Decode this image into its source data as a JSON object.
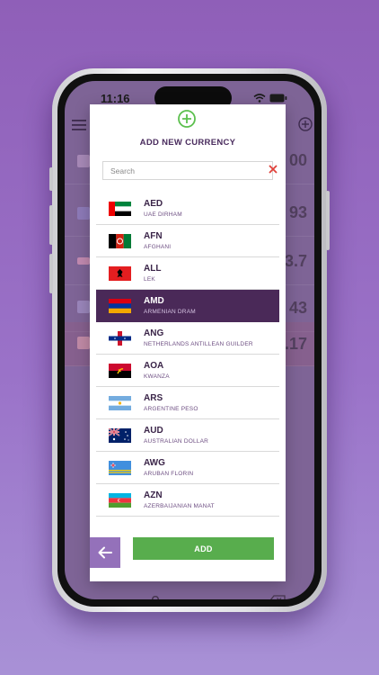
{
  "status": {
    "time": "11:16"
  },
  "background": {
    "values": [
      "00",
      "93",
      "3.7",
      "43",
      ".17"
    ],
    "keypad": {
      "zero": "0",
      "dot": "."
    }
  },
  "modal": {
    "title": "ADD NEW CURRENCY",
    "search_placeholder": "Search",
    "selected_code": "AMD",
    "currencies": [
      {
        "code": "AED",
        "name": "UAE DIRHAM",
        "flag": "uae-flag-icon"
      },
      {
        "code": "AFN",
        "name": "AFGHANI",
        "flag": "afghanistan-flag-icon"
      },
      {
        "code": "ALL",
        "name": "LEK",
        "flag": "albania-flag-icon"
      },
      {
        "code": "AMD",
        "name": "ARMENIAN DRAM",
        "flag": "armenia-flag-icon"
      },
      {
        "code": "ANG",
        "name": "NETHERLANDS ANTILLEAN GUILDER",
        "flag": "netherlands-antilles-flag-icon"
      },
      {
        "code": "AOA",
        "name": "KWANZA",
        "flag": "angola-flag-icon"
      },
      {
        "code": "ARS",
        "name": "ARGENTINE PESO",
        "flag": "argentina-flag-icon"
      },
      {
        "code": "AUD",
        "name": "AUSTRALIAN DOLLAR",
        "flag": "australia-flag-icon"
      },
      {
        "code": "AWG",
        "name": "ARUBAN FLORIN",
        "flag": "aruba-flag-icon"
      },
      {
        "code": "AZN",
        "name": "AZERBAIJANIAN MANAT",
        "flag": "azerbaijan-flag-icon"
      }
    ],
    "add_label": "ADD"
  },
  "colors": {
    "accent": "#4a2958",
    "add_button": "#58ad4d",
    "plus_icon": "#5cc04e",
    "clear_icon": "#e0413a",
    "back_button": "#9471ba"
  }
}
